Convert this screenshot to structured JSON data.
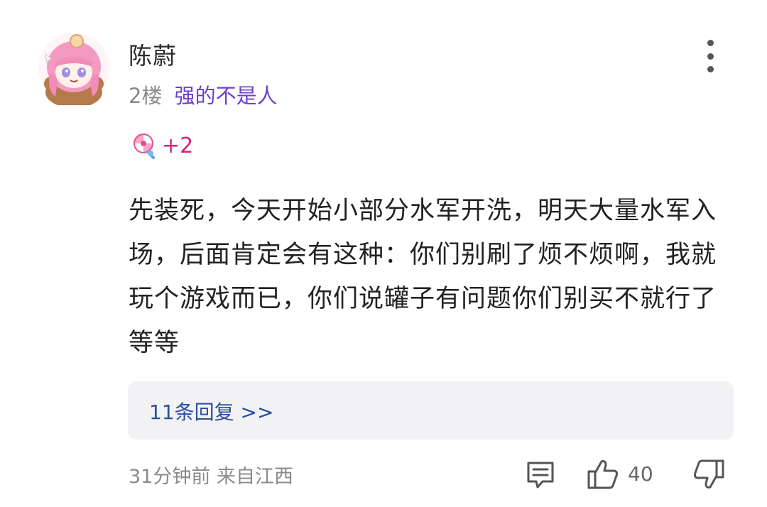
{
  "comment": {
    "username": "陈蔚",
    "floor": "2楼",
    "badge": "强的不是人",
    "gift": {
      "icon": "lollipop-icon",
      "count": "+2"
    },
    "content": "先装死，今天开始小部分水军开洗，明天大量水军入场，后面肯定会有这种：你们别刷了烦不烦啊，我就玩个游戏而已，你们说罐子有问题你们别买不就行了等等",
    "replies_link": "11条回复 >>",
    "time_location": "31分钟前 来自江西",
    "like_count": "40"
  },
  "colors": {
    "badge": "#6b3fd1",
    "gift_count": "#d4237a",
    "reply_link": "#2a4fa0",
    "meta": "#8a8a8a",
    "reply_box_bg": "#f2f2f4"
  },
  "icons": {
    "avatar": "anime-girl-avatar",
    "more": "more-vertical-icon",
    "reply": "comment-icon",
    "like": "thumbs-up-icon",
    "dislike": "thumbs-down-icon"
  }
}
